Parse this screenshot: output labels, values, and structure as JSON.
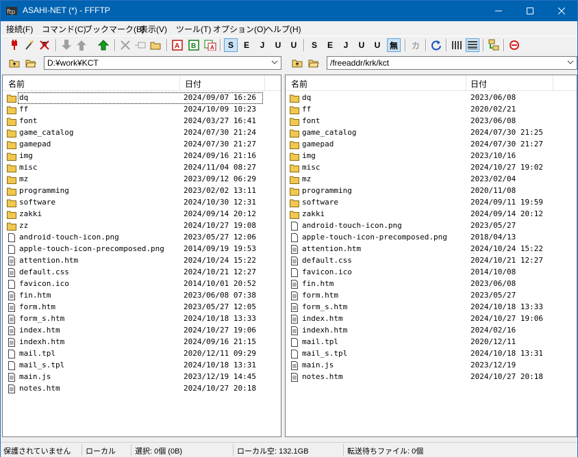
{
  "window": {
    "title": "ASAHI-NET (*) - FFFTP"
  },
  "menu": [
    "接続(F)",
    "コマンド(C)",
    "ブックマーク(B)",
    "表示(V)",
    "ツール(T)",
    "オプション(O)",
    "ヘルプ(H)"
  ],
  "toolbar": {
    "buttons": [
      "connect-icon",
      "quick-connect-icon",
      "disconnect-icon",
      "download-icon",
      "upload-icon",
      "mirror-upload-icon",
      "delete-icon",
      "rename-icon",
      "mkdir-icon",
      "ascii-mode",
      "binary-mode",
      "auto-mode",
      "sjis-local",
      "euc-local",
      "jis-local",
      "utf8-local",
      "utf8bom-local",
      "sjis-remote",
      "euc-remote",
      "jis-remote",
      "utf8-remote",
      "utf8bom-remote",
      "no-convert",
      "kana-convert",
      "refresh-icon",
      "list-view-icon",
      "detail-view-icon",
      "sync-folder-icon",
      "stop-icon"
    ],
    "labels": {
      "ascii": "A",
      "binary": "B",
      "sjis_l": "S",
      "euc_l": "E",
      "jis_l": "J",
      "utf8_l": "U",
      "utf8b_l": "U",
      "sjis_r": "S",
      "euc_r": "E",
      "jis_r": "J",
      "utf8_r": "U",
      "utf8b_r": "U",
      "noconv": "無",
      "kana": "カ"
    }
  },
  "local": {
    "path": "D:¥work¥KCT",
    "col_name": "名前",
    "col_date": "日付",
    "files": [
      {
        "name": "dq",
        "date": "2024/09/07 16:26",
        "type": "folder"
      },
      {
        "name": "ff",
        "date": "2024/10/09 10:23",
        "type": "folder"
      },
      {
        "name": "font",
        "date": "2024/03/27 16:41",
        "type": "folder"
      },
      {
        "name": "game_catalog",
        "date": "2024/07/30 21:24",
        "type": "folder"
      },
      {
        "name": "gamepad",
        "date": "2024/07/30 21:27",
        "type": "folder"
      },
      {
        "name": "img",
        "date": "2024/09/16 21:16",
        "type": "folder"
      },
      {
        "name": "misc",
        "date": "2024/11/04 08:27",
        "type": "folder"
      },
      {
        "name": "mz",
        "date": "2023/09/12 06:29",
        "type": "folder"
      },
      {
        "name": "programming",
        "date": "2023/02/02 13:11",
        "type": "folder"
      },
      {
        "name": "software",
        "date": "2024/10/30 12:31",
        "type": "folder"
      },
      {
        "name": "zakki",
        "date": "2024/09/14 20:12",
        "type": "folder"
      },
      {
        "name": "zz",
        "date": "2024/10/27 19:08",
        "type": "folder"
      },
      {
        "name": "android-touch-icon.png",
        "date": "2023/05/27 12:06",
        "type": "file"
      },
      {
        "name": "apple-touch-icon-precomposed.png",
        "date": "2014/09/19 19:53",
        "type": "file"
      },
      {
        "name": "attention.htm",
        "date": "2024/10/24 15:22",
        "type": "doc"
      },
      {
        "name": "default.css",
        "date": "2024/10/21 12:27",
        "type": "doc"
      },
      {
        "name": "favicon.ico",
        "date": "2014/10/01 20:52",
        "type": "file"
      },
      {
        "name": "fin.htm",
        "date": "2023/06/08 07:38",
        "type": "doc"
      },
      {
        "name": "form.htm",
        "date": "2023/05/27 12:05",
        "type": "doc"
      },
      {
        "name": "form_s.htm",
        "date": "2024/10/18 13:33",
        "type": "doc"
      },
      {
        "name": "index.htm",
        "date": "2024/10/27 19:06",
        "type": "doc"
      },
      {
        "name": "indexh.htm",
        "date": "2024/09/16 21:15",
        "type": "doc"
      },
      {
        "name": "mail.tpl",
        "date": "2020/12/11 09:29",
        "type": "file"
      },
      {
        "name": "mail_s.tpl",
        "date": "2024/10/18 13:31",
        "type": "file"
      },
      {
        "name": "main.js",
        "date": "2023/12/19 14:45",
        "type": "doc"
      },
      {
        "name": "notes.htm",
        "date": "2024/10/27 20:18",
        "type": "doc"
      }
    ]
  },
  "remote": {
    "path": "/freeaddr/krk/kct",
    "col_name": "名前",
    "col_date": "日付",
    "files": [
      {
        "name": "dq",
        "date": "2023/06/08",
        "type": "folder"
      },
      {
        "name": "ff",
        "date": "2020/02/21",
        "type": "folder"
      },
      {
        "name": "font",
        "date": "2023/06/08",
        "type": "folder"
      },
      {
        "name": "game_catalog",
        "date": "2024/07/30 21:25",
        "type": "folder"
      },
      {
        "name": "gamepad",
        "date": "2024/07/30 21:27",
        "type": "folder"
      },
      {
        "name": "img",
        "date": "2023/10/16",
        "type": "folder"
      },
      {
        "name": "misc",
        "date": "2024/10/27 19:02",
        "type": "folder"
      },
      {
        "name": "mz",
        "date": "2023/02/04",
        "type": "folder"
      },
      {
        "name": "programming",
        "date": "2020/11/08",
        "type": "folder"
      },
      {
        "name": "software",
        "date": "2024/09/11 19:59",
        "type": "folder"
      },
      {
        "name": "zakki",
        "date": "2024/09/14 20:12",
        "type": "folder"
      },
      {
        "name": "android-touch-icon.png",
        "date": "2023/05/27",
        "type": "file"
      },
      {
        "name": "apple-touch-icon-precomposed.png",
        "date": "2018/04/13",
        "type": "file"
      },
      {
        "name": "attention.htm",
        "date": "2024/10/24 15:22",
        "type": "doc"
      },
      {
        "name": "default.css",
        "date": "2024/10/21 12:27",
        "type": "doc"
      },
      {
        "name": "favicon.ico",
        "date": "2014/10/08",
        "type": "file"
      },
      {
        "name": "fin.htm",
        "date": "2023/06/08",
        "type": "doc"
      },
      {
        "name": "form.htm",
        "date": "2023/05/27",
        "type": "doc"
      },
      {
        "name": "form_s.htm",
        "date": "2024/10/18 13:33",
        "type": "doc"
      },
      {
        "name": "index.htm",
        "date": "2024/10/27 19:06",
        "type": "doc"
      },
      {
        "name": "indexh.htm",
        "date": "2024/02/16",
        "type": "doc"
      },
      {
        "name": "mail.tpl",
        "date": "2020/12/11",
        "type": "file"
      },
      {
        "name": "mail_s.tpl",
        "date": "2024/10/18 13:31",
        "type": "file"
      },
      {
        "name": "main.js",
        "date": "2023/12/19",
        "type": "doc"
      },
      {
        "name": "notes.htm",
        "date": "2024/10/27 20:18",
        "type": "doc"
      }
    ]
  },
  "status": {
    "protect": "保護されていません",
    "side": "ローカル",
    "selection": "選択: 0個 (0B)",
    "free": "ローカル空: 132.1GB",
    "queue": "転送待ちファイル: 0個"
  },
  "colors": {
    "titlebar": "#0063b1",
    "folder": "#f0c850",
    "selection_border": "#000000"
  }
}
